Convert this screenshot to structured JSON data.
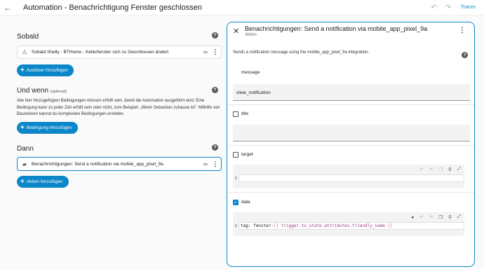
{
  "topbar": {
    "title": "Automation - Benachrichtigung Fenster geschlossen",
    "traces_label": "Traces"
  },
  "left": {
    "triggers": {
      "title": "Sobald",
      "card_text": "Sobald Shelly - BTHome - Kellerfenster sich zu Geschlossen ändert",
      "add_label": "Auslöser hinzufügen"
    },
    "conditions": {
      "title": "Und wenn",
      "subtitle": "(optional)",
      "description": "Alle hier hinzugefügten Bedingungen müssen erfüllt sein, damit die Automation ausgeführt wird. Eine Bedingung kann zu jeder Zeit erfüllt sein oder nicht, zum Beispiel: „Wenn Sebastian zuhause ist\". Mithilfe von Bausteinen kannst du komplexere Bedingungen erstellen.",
      "add_label": "Bedingung hinzufügen"
    },
    "actions": {
      "title": "Dann",
      "card_text": "Benachrichtigungen: Send a notification via mobile_app_pixel_9a",
      "add_label": "Aktion hinzufügen"
    }
  },
  "panel": {
    "title": "Benachrichtigungen: Send a notification via mobile_app_pixel_9a",
    "subtitle": "Aktion",
    "description": "Sends a notification message using the mobile_app_pixel_9a integration.",
    "message_label": "message",
    "message_value": "clear_notification",
    "title_label": "title",
    "target_label": "target",
    "target_line": "1",
    "data_label": "data",
    "data_line": "1",
    "data_code": {
      "key": "tag:",
      "prefix": "fenster-",
      "open": "{{",
      "expr": "trigger.to_state.attributes.friendly_name",
      "close": "}}"
    }
  }
}
